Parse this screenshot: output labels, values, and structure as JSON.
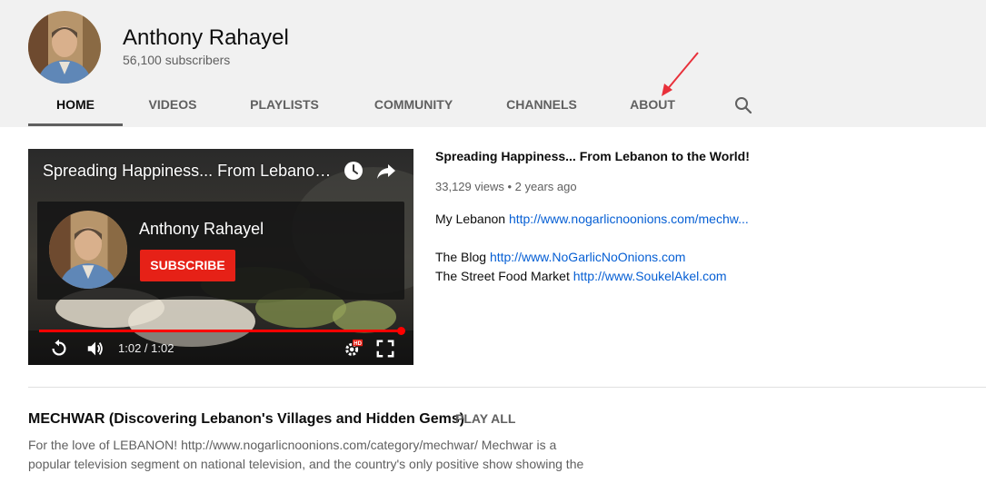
{
  "channel": {
    "name": "Anthony Rahayel",
    "subscribers": "56,100 subscribers"
  },
  "tabs": [
    {
      "label": "HOME",
      "active": true
    },
    {
      "label": "VIDEOS"
    },
    {
      "label": "PLAYLISTS"
    },
    {
      "label": "COMMUNITY"
    },
    {
      "label": "CHANNELS"
    },
    {
      "label": "ABOUT"
    }
  ],
  "icons": {
    "search": "search-icon",
    "watch_later": "clock-icon",
    "share": "share-icon",
    "replay": "replay-icon",
    "volume": "volume-icon",
    "settings": "settings-hd-icon",
    "fullscreen": "fullscreen-icon"
  },
  "player": {
    "title": "Spreading Happiness... From Lebanon to the World!",
    "end_card_channel": "Anthony Rahayel",
    "subscribe_label": "SUBSCRIBE",
    "hd_badge": "HD",
    "time": "1:02 / 1:02",
    "progress": 1.0
  },
  "featured_video": {
    "title": "Spreading Happiness... From Lebanon to the World!",
    "meta": "33,129 views • 2 years ago",
    "description": [
      {
        "text": "My Lebanon ",
        "link": "http://www.nogarlicnoonions.com/mechw..."
      },
      {
        "text": "",
        "link": ""
      },
      {
        "text": "The Blog ",
        "link": "http://www.NoGarlicNoOnions.com"
      },
      {
        "text": "The Street Food Market ",
        "link": "http://www.SoukelAkel.com"
      }
    ]
  },
  "playlist_section": {
    "title": "MECHWAR (Discovering Lebanon's Villages and Hidden Gems)",
    "play_all": "PLAY ALL",
    "description": "For the love of LEBANON! http://www.nogarlicnoonions.com/category/mechwar/ Mechwar is a popular television segment on national television, and the country's only positive show showing the"
  },
  "colors": {
    "header_bg": "#f1f1f1",
    "subscribe_red": "#e62117",
    "progress_red": "#ff0000",
    "link_blue": "#065fd4",
    "annotation_arrow": "#e8303a"
  }
}
